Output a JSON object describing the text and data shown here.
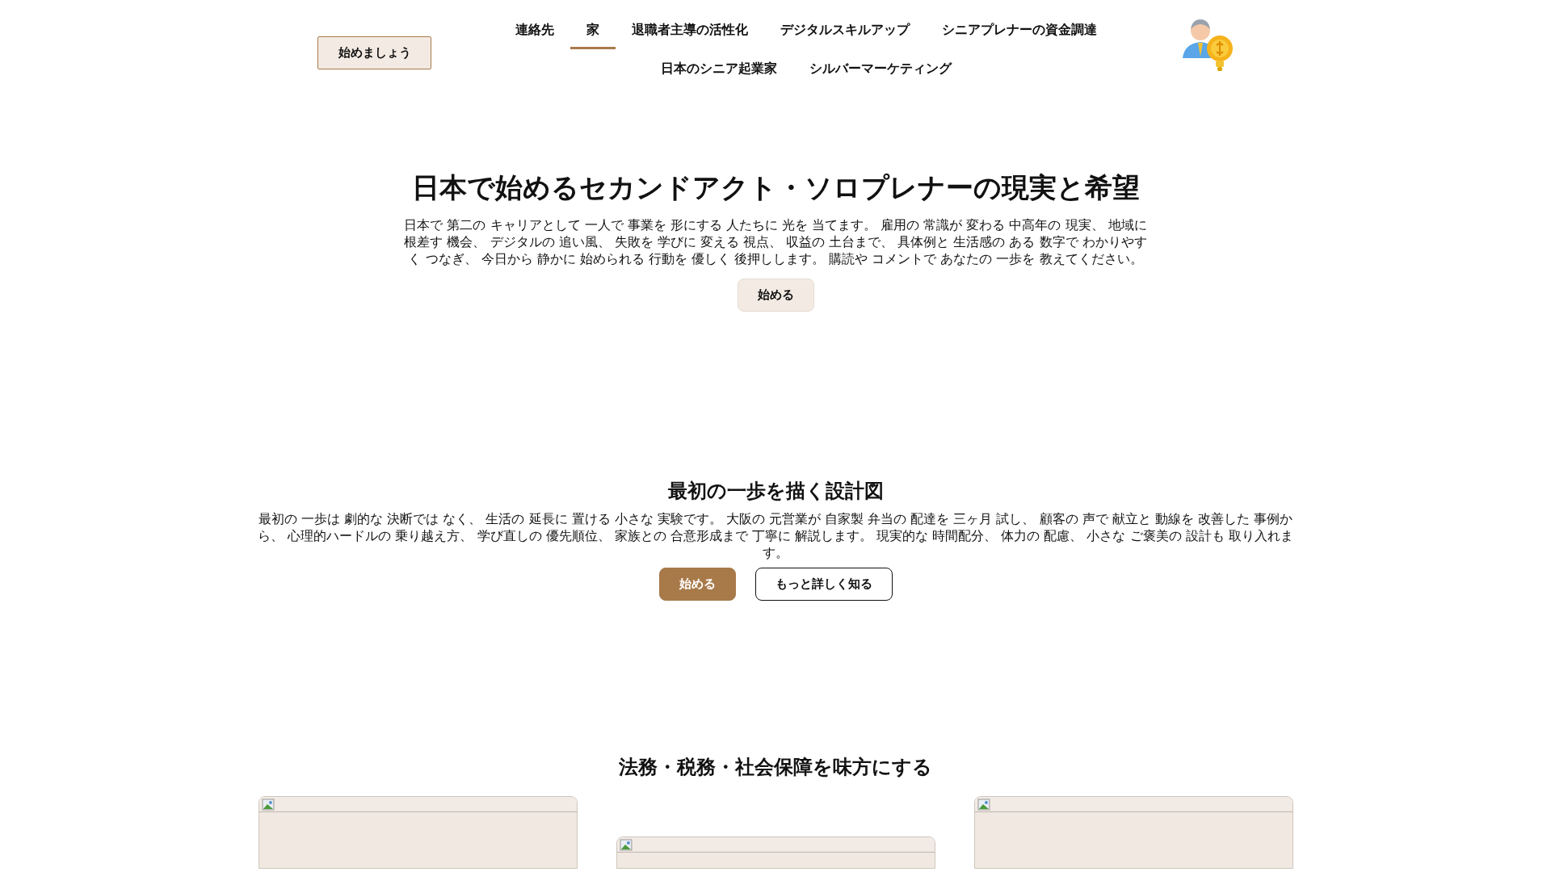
{
  "header": {
    "cta": "始めましょう",
    "nav": [
      {
        "label": "連絡先",
        "selected": false
      },
      {
        "label": "家",
        "selected": true
      },
      {
        "label": "退職者主導の活性化",
        "selected": false
      },
      {
        "label": "デジタルスキルアップ",
        "selected": false
      },
      {
        "label": "シニアプレナーの資金調達",
        "selected": false
      },
      {
        "label": "日本のシニア起業家",
        "selected": false
      },
      {
        "label": "シルバーマーケティング",
        "selected": false
      }
    ]
  },
  "hero": {
    "title": "日本で始めるセカンドアクト・ソロプレナーの現実と希望",
    "text": "日本で 第二の キャリアとして 一人で 事業を 形にする 人たちに 光を 当てます。 雇用の 常識が 変わる 中高年の 現実、 地域に根差す 機会、 デジタルの 追い風、 失敗を 学びに 変える 視点、 収益の 土台まで、 具体例と 生活感の ある 数字で わかりやすく つなぎ、 今日から 静かに 始められる 行動を 優しく 後押しします。 購読や コメントで あなたの 一歩を 教えてください。",
    "button": "始める"
  },
  "blueprint": {
    "title": "最初の一歩を描く設計図",
    "text": "最初の 一歩は 劇的な 決断では なく、 生活の 延長に 置ける 小さな 実験です。 大阪の 元営業が 自家製 弁当の 配達を 三ヶ月 試し、 顧客の 声で 献立と 動線を 改善した 事例から、 心理的ハードルの 乗り越え方、 学び直しの 優先順位、 家族との 合意形成まで 丁寧に 解説します。 現実的な 時間配分、 体力の 配慮、 小さな ご褒美の 設計も 取り入れます。",
    "buttons": [
      {
        "label": "始める",
        "kind": "primary"
      },
      {
        "label": "もっと詳しく知る",
        "kind": "outline"
      }
    ]
  },
  "support": {
    "title": "法務・税務・社会保障を味方にする",
    "cards": [
      {
        "kind": "picture",
        "raised": true
      },
      {
        "kind": "picture",
        "raised": false
      },
      {
        "kind": "picture",
        "raised": true
      }
    ]
  }
}
